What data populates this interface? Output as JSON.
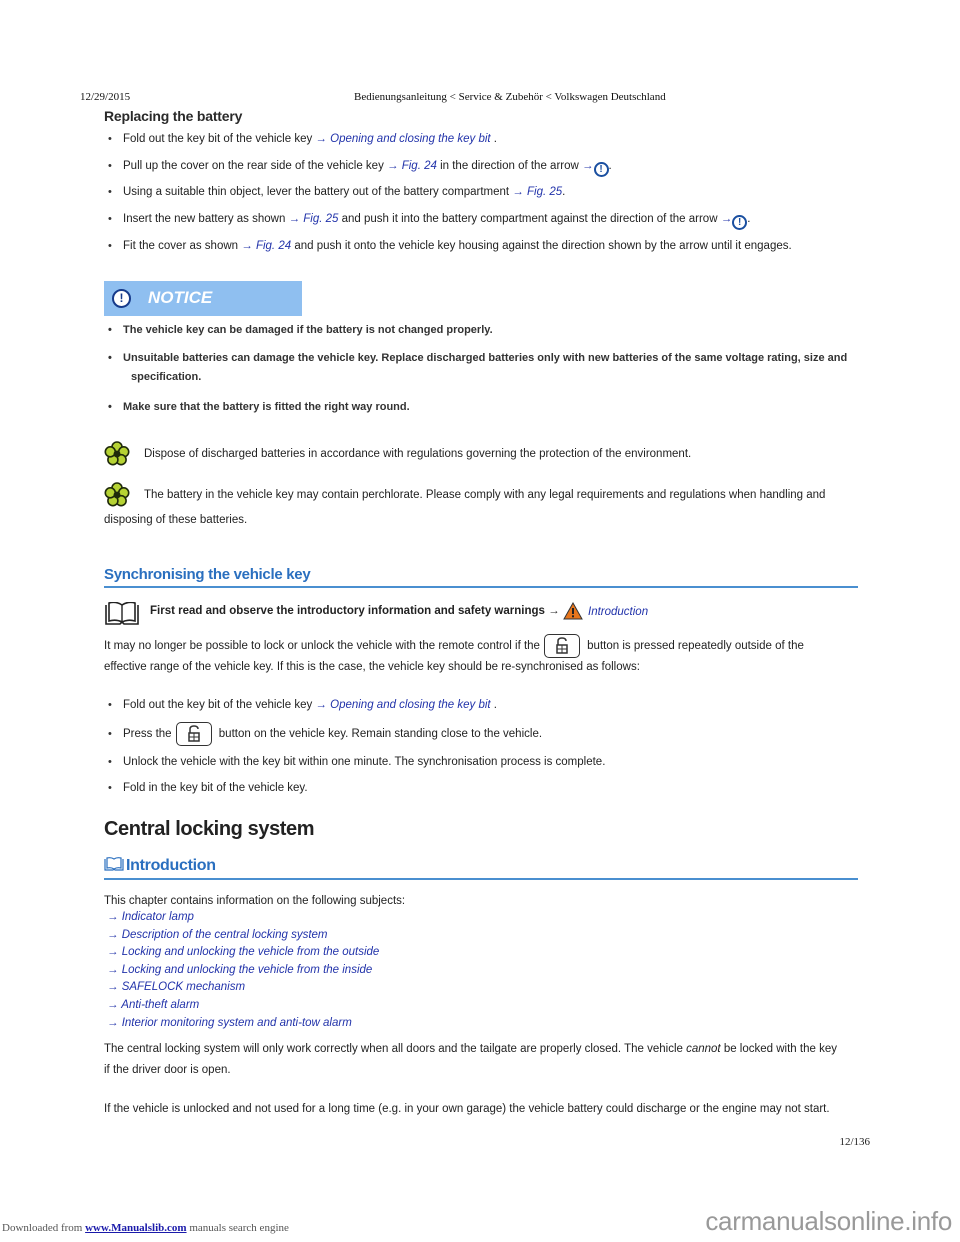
{
  "header": {
    "date": "12/29/2015",
    "title": "Bedienungsanleitung < Service & Zubehör < Volkswagen Deutschland"
  },
  "replacing": {
    "heading": "Replacing the battery",
    "steps": [
      {
        "pre": "Fold out the key bit of the vehicle key ",
        "link": "Opening and closing the key bit",
        "post": " ."
      },
      {
        "pre": "Pull up the cover on the rear side of the vehicle key ",
        "link": "Fig. 24",
        "mid": " in the direction of the arrow ",
        "post": "."
      },
      {
        "pre": "Using a suitable thin object, lever the battery out of the battery compartment ",
        "link": "Fig. 25",
        "post": "."
      },
      {
        "pre": "Insert the new battery as shown ",
        "link": "Fig. 25",
        "mid": " and push it into the battery compartment against the direction of the arrow ",
        "post": "."
      },
      {
        "pre": "Fit the cover as shown ",
        "link": "Fig. 24",
        "post": " and push it onto the vehicle key housing against the direction shown by the arrow until it engages."
      }
    ],
    "arrow": "→",
    "notice_icon": "!"
  },
  "notice": {
    "label": "NOTICE",
    "icon": "!",
    "items": [
      "The vehicle key can be damaged if the battery is not changed properly.",
      "Unsuitable batteries can damage the vehicle key. Replace discharged batteries only with new batteries of the same voltage rating, size and",
      "specification.",
      "Make sure that the battery is fitted the right way round."
    ]
  },
  "environment": {
    "note1": "Dispose of discharged batteries in accordance with regulations governing the protection of the environment.",
    "note2_line1": "The battery in the vehicle key may contain perchlorate. Please comply with any legal requirements and regulations when handling and",
    "note2_line2": "disposing of these batteries."
  },
  "sync": {
    "heading": "Synchronising the vehicle key",
    "first_read": "First read and observe the introductory information and safety warnings →",
    "first_read_link": "Introduction",
    "para_pre": "It may no longer be possible to lock or unlock the vehicle with the remote control if the",
    "para_post": " button is pressed repeatedly outside of the",
    "para_line2": "effective range of the vehicle key. If this is the case, the vehicle key should be re-synchronised as follows:",
    "steps": [
      {
        "pre": "Fold out the key bit of the vehicle key ",
        "link": "Opening and closing the key bit",
        "post": " ."
      },
      {
        "pre": "Press the",
        "post": " button on the vehicle key. Remain standing close to the vehicle."
      },
      {
        "pre": "Unlock the vehicle with the key bit within one minute. The synchronisation process is complete."
      },
      {
        "pre": "Fold in the key bit of the vehicle key."
      }
    ]
  },
  "central": {
    "heading": "Central locking system",
    "intro_heading": "Introduction",
    "chapter_intro": "This chapter contains information on the following subjects:",
    "subjects": [
      "→ Indicator lamp",
      "→ Description of the central locking system",
      "→ Locking and unlocking the vehicle from the outside",
      "→ Locking and unlocking the vehicle from the inside",
      "→ SAFELOCK mechanism",
      "→ Anti-theft alarm",
      "→ Interior monitoring system and anti-tow alarm"
    ],
    "para1_pre": "The central locking system will only work correctly when all doors and the tailgate are properly closed. The vehicle ",
    "para1_em": "cannot",
    "para1_post": " be locked with the key",
    "para1_line2": "if the driver door is open.",
    "para2": "If the vehicle is unlocked and not used for a long time (e.g. in your own garage) the vehicle battery could discharge or the engine may not start."
  },
  "page": {
    "number": "12/136"
  },
  "footer": {
    "downloaded_pre": "Downloaded from ",
    "downloaded_link": "www.Manualslib.com",
    "downloaded_post": " manuals search engine",
    "brand": "carmanualsonline.info"
  },
  "colors": {
    "link": "#2233aa",
    "heading_blue": "#2a6fbf",
    "notice_bg": "#8fbff0",
    "notice_icon": "#163a8a",
    "warning_orange": "#e8761c",
    "flower_green": "#b6d334"
  }
}
